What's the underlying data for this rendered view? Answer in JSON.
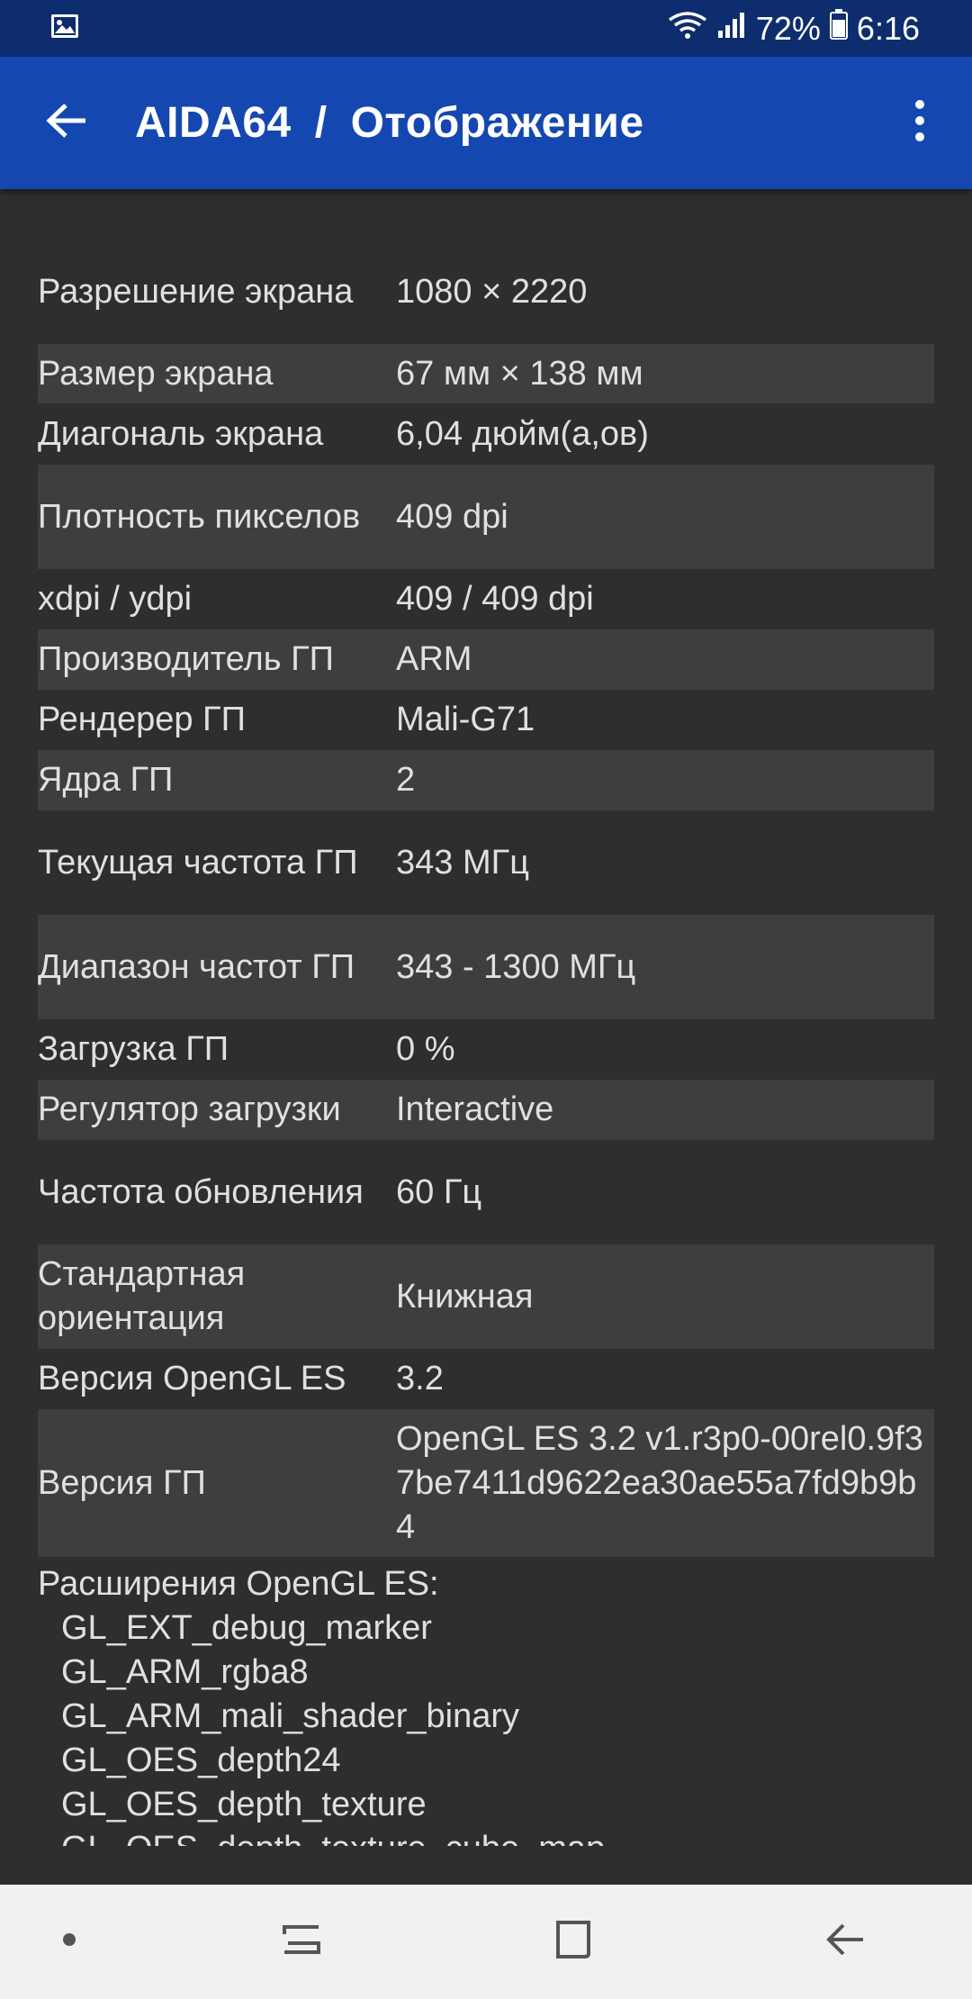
{
  "status_bar": {
    "battery": "72%",
    "time": "6:16",
    "icons": [
      "image-icon",
      "wifi-icon",
      "signal-icon",
      "battery-icon"
    ]
  },
  "app_bar": {
    "app_name": "AIDA64",
    "separator": "/",
    "section": "Отображение",
    "back_icon": "arrow-left-icon",
    "menu_icon": "more-vertical-icon"
  },
  "rows": [
    {
      "label": "Разрешение экрана",
      "value": "1080 × 2220"
    },
    {
      "label": "Размер экрана",
      "value": "67 мм × 138 мм"
    },
    {
      "label": "Диагональ экрана",
      "value": "6,04 дюйм(а,ов)"
    },
    {
      "label": "Плотность пикселов",
      "value": "409 dpi"
    },
    {
      "label": "xdpi / ydpi",
      "value": "409 / 409 dpi"
    },
    {
      "label": "Производитель ГП",
      "value": "ARM"
    },
    {
      "label": "Рендерер ГП",
      "value": "Mali-G71"
    },
    {
      "label": "Ядра ГП",
      "value": "2"
    },
    {
      "label": "Текущая частота ГП",
      "value": "343 МГц"
    },
    {
      "label": "Диапазон частот ГП",
      "value": "343 - 1300 МГц"
    },
    {
      "label": "Загрузка ГП",
      "value": "0 %"
    },
    {
      "label": "Регулятор загрузки",
      "value": "Interactive"
    },
    {
      "label": "Частота обновления",
      "value": "60 Гц"
    },
    {
      "label": "Стандартная ориентация",
      "value": "Книжная"
    },
    {
      "label": "Версия OpenGL ES",
      "value": "3.2"
    },
    {
      "label": "Версия ГП",
      "value": "OpenGL ES 3.2 v1.r3p0-00rel0.9f37be7411d9622ea30ae55a7fd9b9b4"
    }
  ],
  "extensions": {
    "title": "Расширения OpenGL ES:",
    "items": [
      "GL_EXT_debug_marker",
      "GL_ARM_rgba8",
      "GL_ARM_mali_shader_binary",
      "GL_OES_depth24",
      "GL_OES_depth_texture",
      "GL_OES_depth_texture_cube_map"
    ]
  },
  "nav_bar": {
    "buttons": [
      "dot-icon",
      "recent-apps-icon",
      "home-icon",
      "back-icon"
    ]
  },
  "colors": {
    "status_bar": "#0d2d6e",
    "app_bar": "#1448b0",
    "background": "#2e2e2e",
    "row_alt": "#3e3e3e",
    "nav_bar": "#f1f1f1"
  }
}
